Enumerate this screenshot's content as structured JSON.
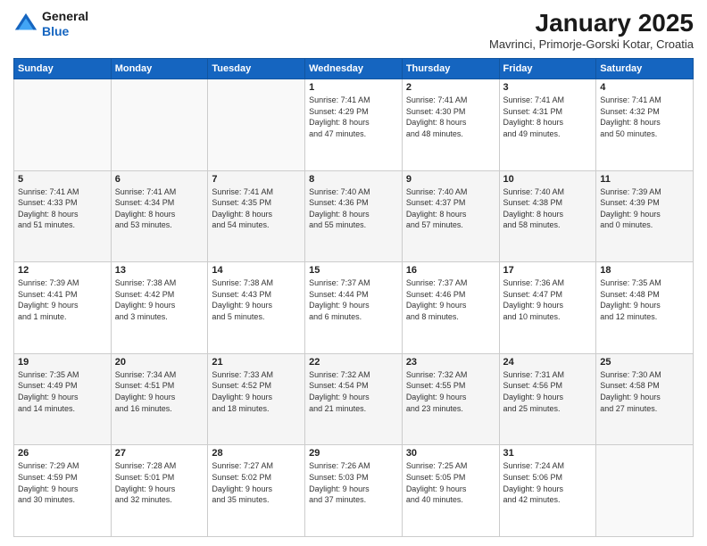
{
  "logo": {
    "line1": "General",
    "line2": "Blue"
  },
  "title": "January 2025",
  "location": "Mavrinci, Primorje-Gorski Kotar, Croatia",
  "weekdays": [
    "Sunday",
    "Monday",
    "Tuesday",
    "Wednesday",
    "Thursday",
    "Friday",
    "Saturday"
  ],
  "weeks": [
    [
      {
        "day": "",
        "text": ""
      },
      {
        "day": "",
        "text": ""
      },
      {
        "day": "",
        "text": ""
      },
      {
        "day": "1",
        "text": "Sunrise: 7:41 AM\nSunset: 4:29 PM\nDaylight: 8 hours\nand 47 minutes."
      },
      {
        "day": "2",
        "text": "Sunrise: 7:41 AM\nSunset: 4:30 PM\nDaylight: 8 hours\nand 48 minutes."
      },
      {
        "day": "3",
        "text": "Sunrise: 7:41 AM\nSunset: 4:31 PM\nDaylight: 8 hours\nand 49 minutes."
      },
      {
        "day": "4",
        "text": "Sunrise: 7:41 AM\nSunset: 4:32 PM\nDaylight: 8 hours\nand 50 minutes."
      }
    ],
    [
      {
        "day": "5",
        "text": "Sunrise: 7:41 AM\nSunset: 4:33 PM\nDaylight: 8 hours\nand 51 minutes."
      },
      {
        "day": "6",
        "text": "Sunrise: 7:41 AM\nSunset: 4:34 PM\nDaylight: 8 hours\nand 53 minutes."
      },
      {
        "day": "7",
        "text": "Sunrise: 7:41 AM\nSunset: 4:35 PM\nDaylight: 8 hours\nand 54 minutes."
      },
      {
        "day": "8",
        "text": "Sunrise: 7:40 AM\nSunset: 4:36 PM\nDaylight: 8 hours\nand 55 minutes."
      },
      {
        "day": "9",
        "text": "Sunrise: 7:40 AM\nSunset: 4:37 PM\nDaylight: 8 hours\nand 57 minutes."
      },
      {
        "day": "10",
        "text": "Sunrise: 7:40 AM\nSunset: 4:38 PM\nDaylight: 8 hours\nand 58 minutes."
      },
      {
        "day": "11",
        "text": "Sunrise: 7:39 AM\nSunset: 4:39 PM\nDaylight: 9 hours\nand 0 minutes."
      }
    ],
    [
      {
        "day": "12",
        "text": "Sunrise: 7:39 AM\nSunset: 4:41 PM\nDaylight: 9 hours\nand 1 minute."
      },
      {
        "day": "13",
        "text": "Sunrise: 7:38 AM\nSunset: 4:42 PM\nDaylight: 9 hours\nand 3 minutes."
      },
      {
        "day": "14",
        "text": "Sunrise: 7:38 AM\nSunset: 4:43 PM\nDaylight: 9 hours\nand 5 minutes."
      },
      {
        "day": "15",
        "text": "Sunrise: 7:37 AM\nSunset: 4:44 PM\nDaylight: 9 hours\nand 6 minutes."
      },
      {
        "day": "16",
        "text": "Sunrise: 7:37 AM\nSunset: 4:46 PM\nDaylight: 9 hours\nand 8 minutes."
      },
      {
        "day": "17",
        "text": "Sunrise: 7:36 AM\nSunset: 4:47 PM\nDaylight: 9 hours\nand 10 minutes."
      },
      {
        "day": "18",
        "text": "Sunrise: 7:35 AM\nSunset: 4:48 PM\nDaylight: 9 hours\nand 12 minutes."
      }
    ],
    [
      {
        "day": "19",
        "text": "Sunrise: 7:35 AM\nSunset: 4:49 PM\nDaylight: 9 hours\nand 14 minutes."
      },
      {
        "day": "20",
        "text": "Sunrise: 7:34 AM\nSunset: 4:51 PM\nDaylight: 9 hours\nand 16 minutes."
      },
      {
        "day": "21",
        "text": "Sunrise: 7:33 AM\nSunset: 4:52 PM\nDaylight: 9 hours\nand 18 minutes."
      },
      {
        "day": "22",
        "text": "Sunrise: 7:32 AM\nSunset: 4:54 PM\nDaylight: 9 hours\nand 21 minutes."
      },
      {
        "day": "23",
        "text": "Sunrise: 7:32 AM\nSunset: 4:55 PM\nDaylight: 9 hours\nand 23 minutes."
      },
      {
        "day": "24",
        "text": "Sunrise: 7:31 AM\nSunset: 4:56 PM\nDaylight: 9 hours\nand 25 minutes."
      },
      {
        "day": "25",
        "text": "Sunrise: 7:30 AM\nSunset: 4:58 PM\nDaylight: 9 hours\nand 27 minutes."
      }
    ],
    [
      {
        "day": "26",
        "text": "Sunrise: 7:29 AM\nSunset: 4:59 PM\nDaylight: 9 hours\nand 30 minutes."
      },
      {
        "day": "27",
        "text": "Sunrise: 7:28 AM\nSunset: 5:01 PM\nDaylight: 9 hours\nand 32 minutes."
      },
      {
        "day": "28",
        "text": "Sunrise: 7:27 AM\nSunset: 5:02 PM\nDaylight: 9 hours\nand 35 minutes."
      },
      {
        "day": "29",
        "text": "Sunrise: 7:26 AM\nSunset: 5:03 PM\nDaylight: 9 hours\nand 37 minutes."
      },
      {
        "day": "30",
        "text": "Sunrise: 7:25 AM\nSunset: 5:05 PM\nDaylight: 9 hours\nand 40 minutes."
      },
      {
        "day": "31",
        "text": "Sunrise: 7:24 AM\nSunset: 5:06 PM\nDaylight: 9 hours\nand 42 minutes."
      },
      {
        "day": "",
        "text": ""
      }
    ]
  ]
}
